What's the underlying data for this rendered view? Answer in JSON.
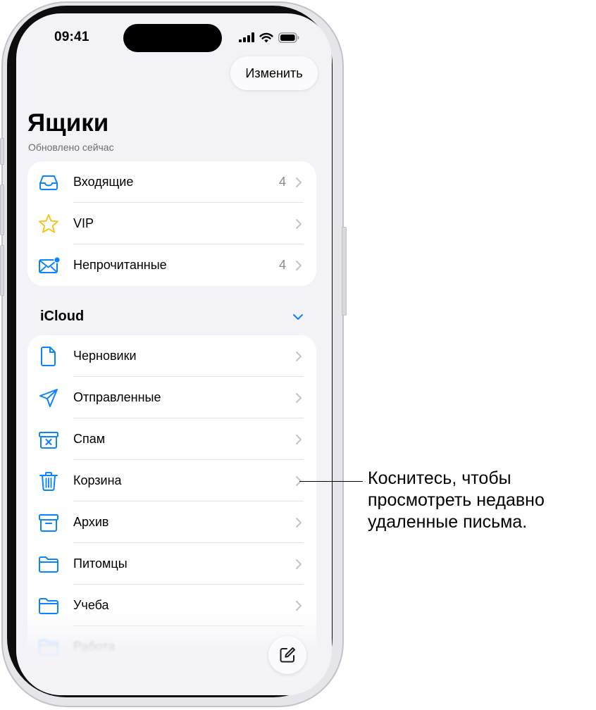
{
  "status_bar": {
    "time": "09:41"
  },
  "toolbar": {
    "edit_label": "Изменить"
  },
  "header": {
    "title": "Ящики",
    "subtitle": "Обновлено сейчас"
  },
  "smart_mailboxes": [
    {
      "label": "Входящие",
      "count": "4",
      "icon": "inbox-tray-icon"
    },
    {
      "label": "VIP",
      "count": "",
      "icon": "star-icon"
    },
    {
      "label": "Непрочитанные",
      "count": "4",
      "icon": "unread-envelope-icon"
    }
  ],
  "account_section": {
    "title": "iCloud",
    "mailboxes": [
      {
        "label": "Черновики",
        "icon": "document-icon"
      },
      {
        "label": "Отправленные",
        "icon": "paper-plane-icon"
      },
      {
        "label": "Спам",
        "icon": "junk-box-icon"
      },
      {
        "label": "Корзина",
        "icon": "trash-icon"
      },
      {
        "label": "Архив",
        "icon": "archive-box-icon"
      },
      {
        "label": "Питомцы",
        "icon": "folder-icon"
      },
      {
        "label": "Учеба",
        "icon": "folder-icon"
      },
      {
        "label": "Работа",
        "icon": "folder-icon"
      }
    ]
  },
  "callout": {
    "lines": [
      "Коснитесь, чтобы",
      "просмотреть недавно",
      "удаленные письма."
    ]
  },
  "colors": {
    "accent": "#0a84ff",
    "vip_star": "#f5c518",
    "background": "#f2f2f7",
    "card": "#ffffff",
    "secondary_text": "#8a8a8e"
  }
}
